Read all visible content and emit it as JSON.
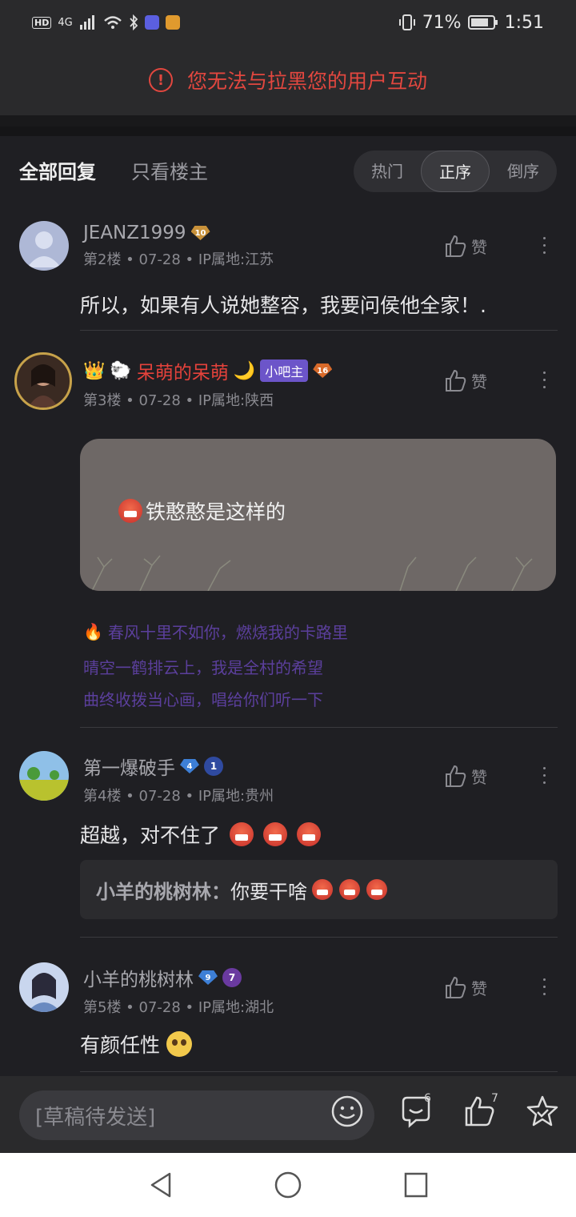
{
  "status_bar": {
    "network": "4G",
    "battery": "71%",
    "time": "1:51"
  },
  "warning": {
    "text": "您无法与拉黑您的用户互动"
  },
  "tabs": {
    "all": "全部回复",
    "op_only": "只看楼主"
  },
  "sort": {
    "hot": "热门",
    "asc": "正序",
    "desc": "倒序",
    "active": "正序"
  },
  "posts": [
    {
      "username": "JEANZ1999",
      "level": "10",
      "meta": "第2楼 • 07-28 • IP属地:江苏",
      "like_label": "赞",
      "content": "所以，如果有人说她整容，我要问侯他全家！."
    },
    {
      "username": "呆萌的呆萌",
      "level": "16",
      "mod_tag": "小吧主",
      "meta": "第3楼 • 07-28 • IP属地:陕西",
      "like_label": "赞",
      "bubble_text": "铁憨憨是这样的",
      "signature": [
        "春风十里不如你，燃烧我的卡路里",
        "晴空一鹤排云上，我是全村的希望",
        "曲终收拨当心画，唱给你们听一下"
      ]
    },
    {
      "username": "第一爆破手",
      "level": "4",
      "badge": "1",
      "meta": "第4楼 • 07-28 • IP属地:贵州",
      "like_label": "赞",
      "content": "超越，对不住了",
      "reply": {
        "name": "小羊的桃树林：",
        "text": "你要干啥"
      }
    },
    {
      "username": "小羊的桃树林",
      "level": "9",
      "badge": "7",
      "meta": "第5楼 • 07-28 • IP属地:湖北",
      "like_label": "赞",
      "content": "有颜任性"
    }
  ],
  "bottom_bar": {
    "draft_placeholder": "[草稿待发送]",
    "comment_count": "6",
    "like_count": "7"
  },
  "colors": {
    "background": "#1f1f23",
    "warning_red": "#e2473f",
    "username_red": "#e5423b",
    "mod_purple": "#6c55c9"
  }
}
